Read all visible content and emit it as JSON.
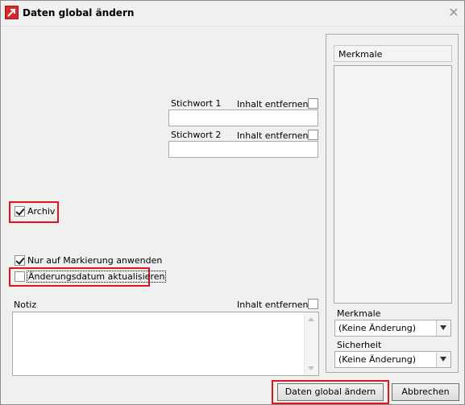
{
  "window": {
    "title": "Daten global ändern",
    "close_icon": "close-icon"
  },
  "fields": {
    "stichwort1": {
      "label": "Stichwort 1",
      "clear_label": "Inhalt entfernen",
      "value": ""
    },
    "stichwort2": {
      "label": "Stichwort 2",
      "clear_label": "Inhalt entfernen",
      "value": ""
    }
  },
  "options": {
    "archiv": {
      "label": "Archiv",
      "checked": true
    },
    "nur_markierung": {
      "label": "Nur auf Markierung anwenden",
      "checked": true
    },
    "aenderungsdatum": {
      "label": "Änderungsdatum aktualisieren",
      "checked": false
    }
  },
  "notiz": {
    "label": "Notiz",
    "clear_label": "Inhalt entfernen",
    "value": ""
  },
  "side": {
    "merkmale_header": "Merkmale",
    "merkmale_label": "Merkmale",
    "merkmale_value": "(Keine Änderung)",
    "sicherheit_label": "Sicherheit",
    "sicherheit_value": "(Keine Änderung)"
  },
  "buttons": {
    "apply": "Daten global ändern",
    "cancel": "Abbrechen"
  },
  "colors": {
    "highlight": "#e0151e",
    "background": "#f0f0f0"
  }
}
